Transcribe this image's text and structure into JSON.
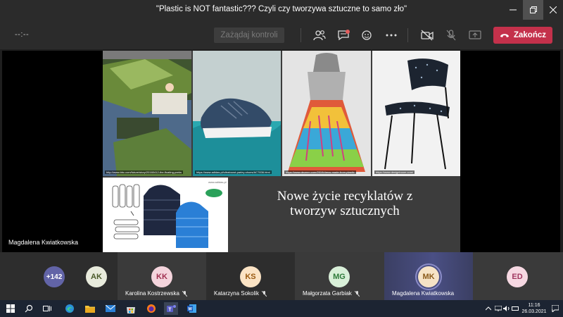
{
  "window": {
    "title": "\"Plastic is NOT fantastic??? Czyli czy tworzywa sztuczne to samo zło\""
  },
  "toolbar": {
    "timer": "--:--",
    "request_control_label": "Zażądaj kontroli",
    "end_call_label": "Zakończ"
  },
  "stage": {
    "presenter_name": "Magdalena Kwiatkowska"
  },
  "slide": {
    "title": "Nowe życie recyklatów z tworzyw sztucznych",
    "captions": [
      "http://www.bbc.com/future/story/20160412-the-floating-parks",
      "https://www.adidas.pl/ultraboost-parley-shoes/AC7836.html",
      "https://www.dezeen.com/2019/dress-made-from-plastic",
      "https://www.designboom.com/"
    ],
    "logo_text": "www.adidas.pl"
  },
  "participants": {
    "overflow_count": "+142",
    "list": [
      {
        "initials": "AK",
        "name": "",
        "avatar_bg": "#e8ebdc",
        "avatar_fg": "#4a5a2a"
      },
      {
        "initials": "KK",
        "name": "Karolina Kostrzewska",
        "avatar_bg": "#f4d4dc",
        "avatar_fg": "#a03050"
      },
      {
        "initials": "KS",
        "name": "Katarzyna Sokolik",
        "avatar_bg": "#fbe3c4",
        "avatar_fg": "#9a5a10"
      },
      {
        "initials": "MG",
        "name": "Małgorzata Garbiak",
        "avatar_bg": "#d8efd8",
        "avatar_fg": "#2e7a3a"
      },
      {
        "initials": "MK",
        "name": "Magdalena Kwiatkowska",
        "avatar_bg": "#f6e3c6",
        "avatar_fg": "#8a5a1a"
      },
      {
        "initials": "ED",
        "name": "",
        "avatar_bg": "#f6d8e2",
        "avatar_fg": "#a03860"
      }
    ]
  },
  "taskbar": {
    "time": "11:16",
    "date": "26.03.2021"
  },
  "colors": {
    "end_call": "#c4314b",
    "overflow_badge": "#6264a7",
    "speaking_ring": "#8b8cc7"
  }
}
